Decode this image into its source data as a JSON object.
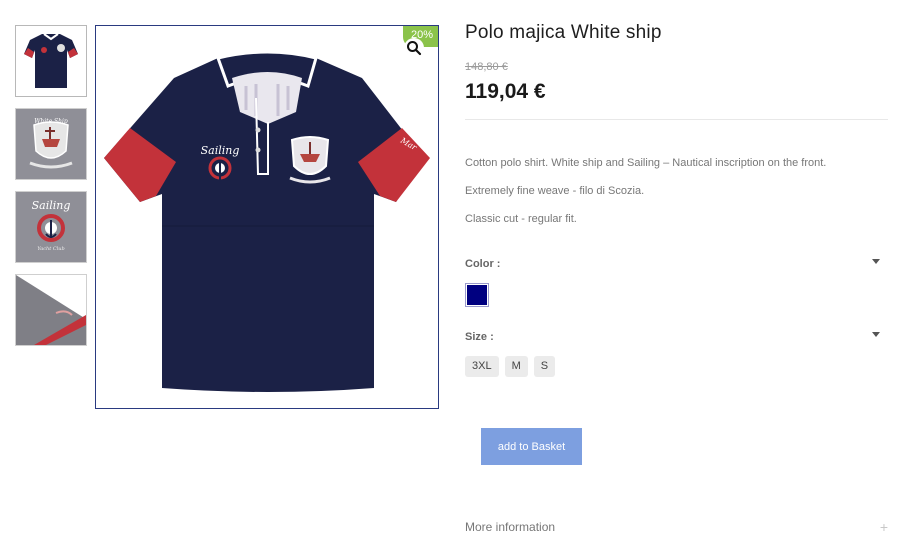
{
  "product": {
    "title": "Polo majica White ship",
    "old_price": "148,80 €",
    "price": "119,04 €",
    "discount_badge": "20%",
    "description": [
      "Cotton polo shirt. White ship and Sailing – Nautical inscription on the front.",
      "Extremely fine weave - filo di Scozia.",
      "Classic cut - regular fit."
    ]
  },
  "gallery": {
    "thumbnails": [
      {
        "name": "thumb-front-shirt"
      },
      {
        "name": "thumb-white-ship-emblem"
      },
      {
        "name": "thumb-sailing-emblem"
      },
      {
        "name": "thumb-sleeve-detail"
      }
    ],
    "zoom_icon": "magnifier-icon"
  },
  "options": {
    "color_label": "Color :",
    "color_swatch": "#000080",
    "size_label": "Size :",
    "sizes": [
      "3XL",
      "M",
      "S"
    ]
  },
  "actions": {
    "add_to_basket": "add to Basket",
    "more_information": "More information",
    "more_plus": "+"
  },
  "colors": {
    "shirt_navy": "#1b2146",
    "cuff_red": "#c3323a",
    "button_blue": "#7d9fe0",
    "badge_green": "#8bc34a"
  }
}
